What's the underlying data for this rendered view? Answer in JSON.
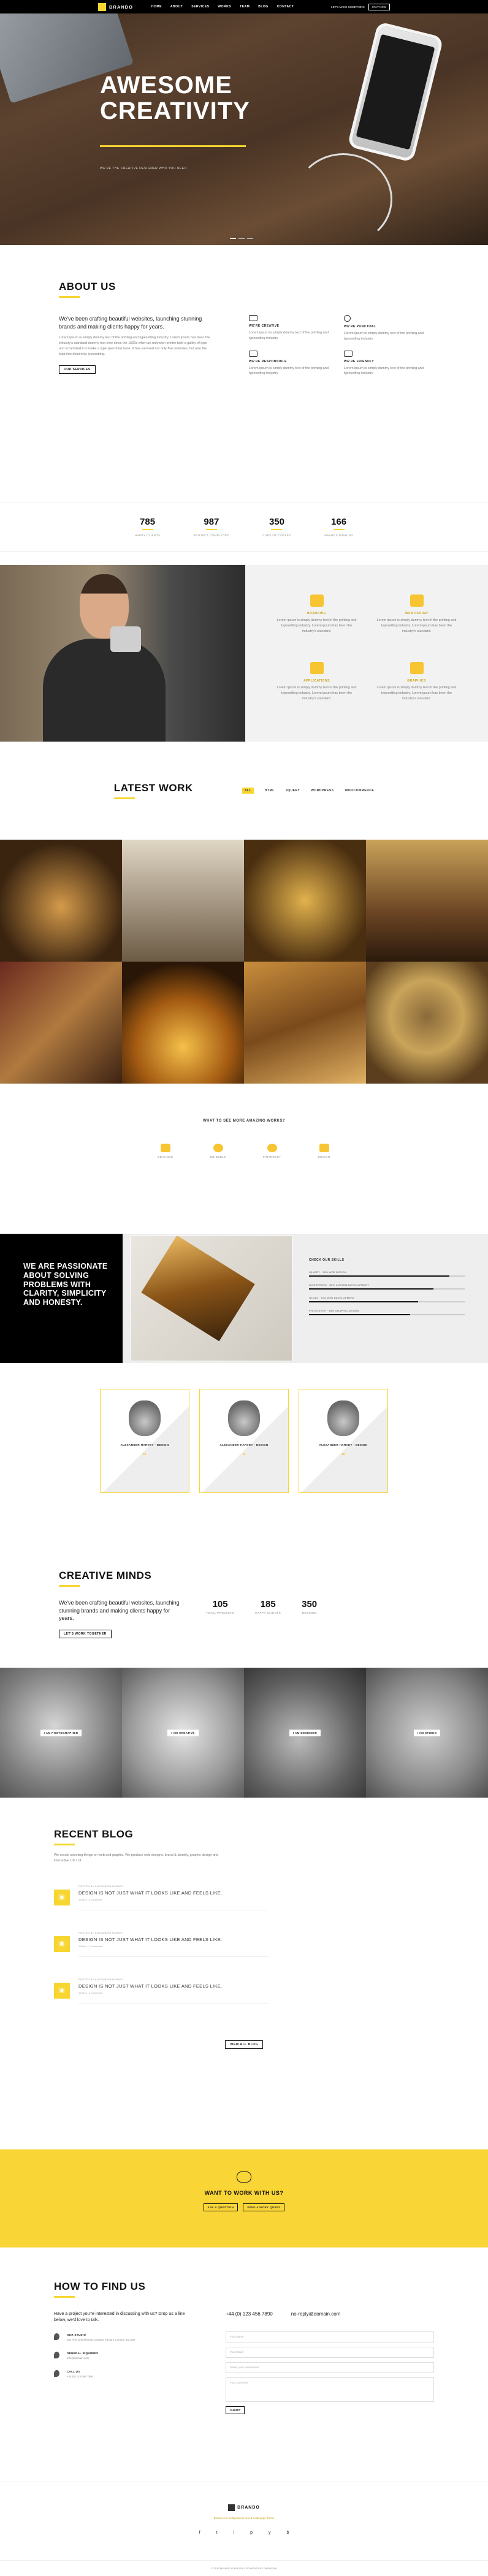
{
  "nav": {
    "brand": "BRANDO",
    "menu": [
      "HOME",
      "ABOUT",
      "SERVICES",
      "WORKS",
      "TEAM",
      "BLOG",
      "CONTACT"
    ],
    "tagline": "LET'S MAKE SOMETHING",
    "cta": "STAY NOW"
  },
  "hero": {
    "title_1": "AWESOME",
    "title_2": "CREATIVITY",
    "subtitle": "WE'RE THE CREATIVE DESIGNER WHO YOU NEED"
  },
  "about": {
    "heading": "ABOUT US",
    "lead": "We've been crafting beautiful websites, launching stunning brands and making clients happy for years.",
    "body": "Lorem ipsum is simply dummy text of the printing and typesetting industry. Lorem ipsum has been the industry's standard dummy text ever since the 1500s when an unknown printer took a galley of type and scrambled it to make a type specimen book. It has survived not only five centuries, but also the leap into electronic typesetting.",
    "button": "OUR SERVICES",
    "features": [
      {
        "title": "WE'RE CREATIVE",
        "text": "Lorem ipsum is simply dummy text of the printing and typesetting industry."
      },
      {
        "title": "WE'RE PUNCTUAL",
        "text": "Lorem ipsum is simply dummy text of the printing and typesetting industry."
      },
      {
        "title": "WE'RE RESPONSIBLE",
        "text": "Lorem ipsum is simply dummy text of the printing and typesetting industry."
      },
      {
        "title": "WE'RE FRIENDLY",
        "text": "Lorem ipsum is simply dummy text of the printing and typesetting industry."
      }
    ]
  },
  "counters": [
    {
      "value": "785",
      "label": "HAPPY CLIENTS"
    },
    {
      "value": "987",
      "label": "PROJECT COMPLETED"
    },
    {
      "value": "350",
      "label": "CUPS OF COFFEE"
    },
    {
      "value": "166",
      "label": "AWARDS WINNING"
    }
  ],
  "services": [
    {
      "title": "BRANDING",
      "text": "Lorem ipsum is simply dummy text of the printing and typesetting industry. Lorem ipsum has been the industry's standard."
    },
    {
      "title": "WEB DESIGN",
      "text": "Lorem ipsum is simply dummy text of the printing and typesetting industry. Lorem ipsum has been the industry's standard."
    },
    {
      "title": "APPLICATIONS",
      "text": "Lorem ipsum is simply dummy text of the printing and typesetting industry. Lorem ipsum has been the industry's standard."
    },
    {
      "title": "GRAPHICS",
      "text": "Lorem ipsum is simply dummy text of the printing and typesetting industry. Lorem ipsum has been the industry's standard."
    }
  ],
  "work": {
    "heading": "LATEST WORK",
    "filters": [
      "ALL",
      "HTML",
      "JQUERY",
      "WORDPRESS",
      "WOOCOMMERCE"
    ]
  },
  "more": {
    "heading": "WHAT TO SEE MORE AMAZING WORKS?",
    "items": [
      "BEHANCE",
      "DRIBBBLE",
      "PINTEREST",
      "DESIGN"
    ]
  },
  "skills": {
    "statement": "WE ARE PASSIONATE ABOUT SOLVING PROBLEMS WITH CLARITY, SIMPLICITY AND HONESTY.",
    "heading": "CHECK OUR SKILLS",
    "items": [
      {
        "label": "JQUERY · 90% WEB DESIGN",
        "pct": 90
      },
      {
        "label": "WORDPRESS · 80% CUSTOM DEVELOPMENT",
        "pct": 80
      },
      {
        "label": "HTML5 · 70% WEB DEVELOPMENT",
        "pct": 70
      },
      {
        "label": "PHOTOSHOP · 65% GRAPHIC DESIGN",
        "pct": 65
      }
    ]
  },
  "team": [
    {
      "name": "ALEXANDER HARVEY - DESIGN"
    },
    {
      "name": "ALEXANDER HARVEY - DESIGN"
    },
    {
      "name": "ALEXANDER HARVEY - DESIGN"
    }
  ],
  "creative": {
    "heading": "CREATIVE MINDS",
    "lead": "We've been crafting beautiful websites, launching stunning brands and making clients happy for years.",
    "button": "LET'S WORK TOGETHER",
    "counters": [
      {
        "value": "105",
        "label": "TOTAL PROJECTS"
      },
      {
        "value": "185",
        "label": "HAPPY CLIENTS"
      },
      {
        "value": "350",
        "label": "DESIGNS"
      }
    ]
  },
  "portraits": [
    "I AM PHOTOGRAPHER",
    "I AM CREATIVE",
    "I AM DESIGNER",
    "I AM STUDIO"
  ],
  "blog": {
    "heading": "RECENT BLOG",
    "intro": "We create stunning things on web and graphic. We produce web designs, brand & identity, graphic design and interactive UX / UI.",
    "posts": [
      {
        "meta": "POSTED BY ALEXANDER HARVEY",
        "title": "DESIGN IS NOT JUST WHAT IT LOOKS LIKE AND FEELS LIKE.",
        "stats": "15 likes · 8 comments"
      },
      {
        "meta": "POSTED BY ALEXANDER HARVEY",
        "title": "DESIGN IS NOT JUST WHAT IT LOOKS LIKE AND FEELS LIKE.",
        "stats": "15 likes · 8 comments"
      },
      {
        "meta": "POSTED BY ALEXANDER HARVEY",
        "title": "DESIGN IS NOT JUST WHAT IT LOOKS LIKE AND FEELS LIKE.",
        "stats": "15 likes · 8 comments"
      }
    ],
    "button": "VIEW ALL BLOG"
  },
  "cta": {
    "heading": "WANT TO WORK WITH US?",
    "btn1": "ASK A QUESTION",
    "btn2": "SEND A WORK QUERY"
  },
  "contact": {
    "heading": "HOW TO FIND US",
    "lead": "Have a project you're interested in discussing with us? Drop us a line below, we'd love to talk.",
    "phone": "+44 (0) 123 456 7890",
    "email": "no-reply@domain.com",
    "items": [
      {
        "title": "OUR STUDIO",
        "text": "301 The Greenhouse, Custard Factory, London, E2 8DY"
      },
      {
        "title": "GENERAL INQUIRIES",
        "text": "info@domain.com"
      },
      {
        "title": "CALL US",
        "text": "+44 (0) 123 456 7890"
      }
    ],
    "fields": [
      "Your Name",
      "Your Email",
      "Select your requirement",
      "Your Comment"
    ],
    "submit": "SUBMIT"
  },
  "footer": {
    "brand": "BRANDO",
    "sub": "Brando is a multipurpose one & multi page theme",
    "social": [
      "f",
      "t",
      "i",
      "p",
      "y",
      "b"
    ],
    "copy": "© 2017 BRANDO IS PROUDLY POWERED BY THEMEZAA"
  },
  "colors": {
    "accent": "#f7d631",
    "dark": "#000000"
  }
}
